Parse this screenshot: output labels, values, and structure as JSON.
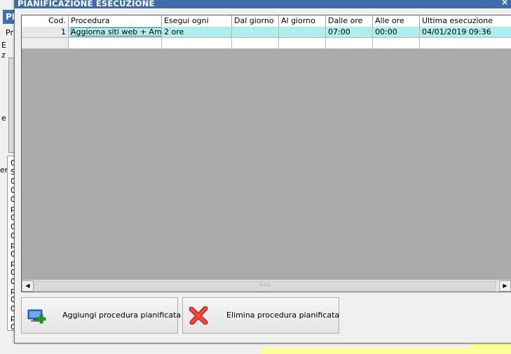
{
  "background": {
    "title_fragment": "PR",
    "labels": [
      "Pr",
      "E",
      "z",
      "e",
      "er"
    ],
    "list_items": [
      "0",
      "S",
      "0",
      "0",
      "0",
      "p",
      "0",
      "0",
      "0",
      "p",
      "0",
      "p",
      "0",
      "0",
      "p",
      "0",
      "0",
      "p",
      "0"
    ]
  },
  "dialog": {
    "title": "PIANIFICAZIONE ESECUZIONE",
    "close_symbol": "×"
  },
  "grid": {
    "columns": [
      "Cod.",
      "Procedura",
      "Esegui ogni",
      "Dal giorno",
      "Al giorno",
      "Dalle ore",
      "Alle ore",
      "Ultima esecuzione"
    ],
    "rows": [
      [
        "1",
        "Aggiorna siti web + Am…",
        "2 ore",
        "",
        "",
        "07:00",
        "00:00",
        "04/01/2019 09:36"
      ]
    ],
    "selected_row_color": "#aeeeee",
    "empty_area_color": "#ababab"
  },
  "scrollbar": {
    "left_arrow": "◀",
    "right_arrow": "▶",
    "grip": "⠿⠿⠿"
  },
  "buttons": {
    "add_label": "Aggiungi procedura pianificata",
    "add_icon": "monitor-plus-icon",
    "delete_label": "Elimina procedura pianificata",
    "delete_icon": "red-x-icon"
  }
}
